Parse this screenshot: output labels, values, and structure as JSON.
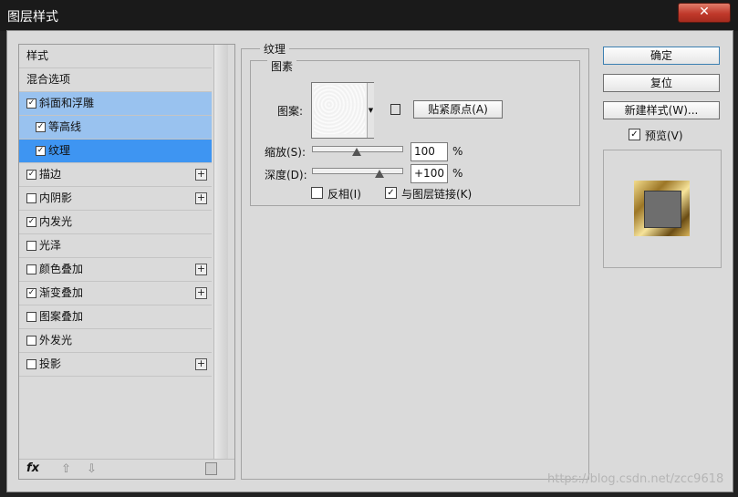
{
  "window": {
    "title": "图层样式",
    "close_label": "✕"
  },
  "left_panel": {
    "items": [
      {
        "label": "样式",
        "checkbox": false,
        "plus": false
      },
      {
        "label": "混合选项",
        "checkbox": false,
        "plus": false
      },
      {
        "label": "斜面和浮雕",
        "checkbox": true,
        "checked": true,
        "plus": false
      },
      {
        "label": "等高线",
        "checkbox": true,
        "checked": true,
        "plus": false
      },
      {
        "label": "纹理",
        "checkbox": true,
        "checked": true,
        "plus": false
      },
      {
        "label": "描边",
        "checkbox": true,
        "checked": true,
        "plus": true
      },
      {
        "label": "内阴影",
        "checkbox": true,
        "checked": false,
        "plus": true
      },
      {
        "label": "内发光",
        "checkbox": true,
        "checked": true,
        "plus": false
      },
      {
        "label": "光泽",
        "checkbox": true,
        "checked": false,
        "plus": false
      },
      {
        "label": "颜色叠加",
        "checkbox": true,
        "checked": false,
        "plus": true
      },
      {
        "label": "渐变叠加",
        "checkbox": true,
        "checked": true,
        "plus": true
      },
      {
        "label": "图案叠加",
        "checkbox": true,
        "checked": false,
        "plus": false
      },
      {
        "label": "外发光",
        "checkbox": true,
        "checked": false,
        "plus": false
      },
      {
        "label": "投影",
        "checkbox": true,
        "checked": false,
        "plus": true
      }
    ],
    "footer": {
      "fx": "fx",
      "up": "⇧",
      "down": "⇩"
    }
  },
  "texture": {
    "section_title": "纹理",
    "group_title": "图素",
    "pattern_label": "图案:",
    "snap_button": "贴紧原点(A)",
    "scale_label": "缩放(S):",
    "scale_value": "100",
    "scale_unit": "%",
    "scale_level": 100,
    "depth_label": "深度(D):",
    "depth_value": "+100",
    "depth_unit": "%",
    "depth_level": 100,
    "invert_label": "反相(I)",
    "invert_checked": false,
    "link_label": "与图层链接(K)",
    "link_checked": true
  },
  "actions": {
    "ok": "确定",
    "reset": "复位",
    "new_style": "新建样式(W)...",
    "preview_label": "预览(V)",
    "preview_checked": true
  },
  "watermark": "https://blog.csdn.net/zcc9618",
  "colors": {
    "selection_light": "#99c2ef",
    "selection_dark": "#3e95f2",
    "gold": "#c9a441"
  }
}
